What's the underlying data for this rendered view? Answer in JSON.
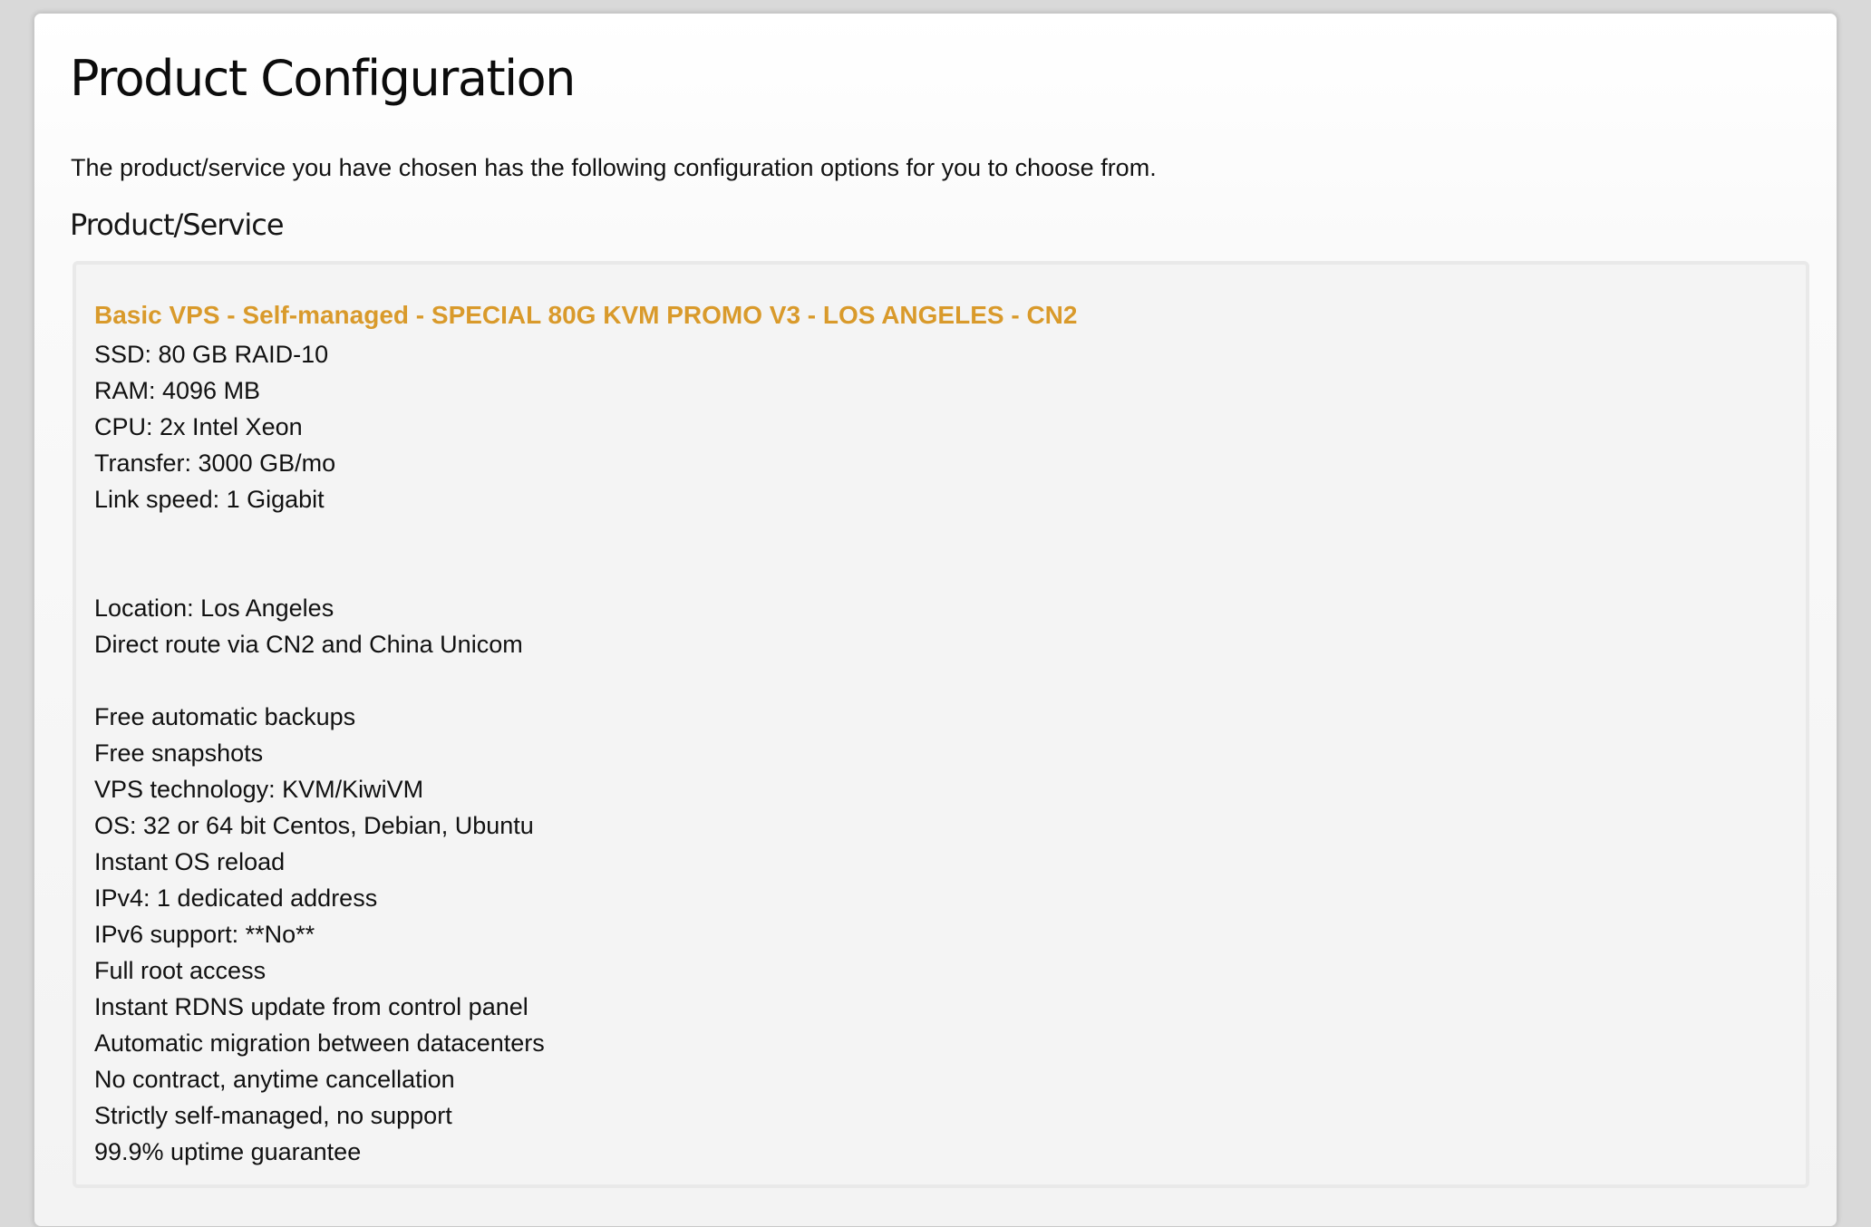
{
  "page": {
    "title": "Product Configuration",
    "intro": "The product/service you have chosen has the following configuration options for you to choose from.",
    "section_heading": "Product/Service"
  },
  "product": {
    "name": "Basic VPS - Self-managed - SPECIAL 80G KVM PROMO V3 - LOS ANGELES - CN2",
    "name_color": "#d99a2b",
    "specs": [
      "SSD: 80 GB RAID-10",
      "RAM: 4096 MB",
      "CPU: 2x Intel Xeon",
      "Transfer: 3000 GB/mo",
      "Link speed: 1 Gigabit",
      "",
      "",
      "Location: Los Angeles",
      "Direct route via CN2 and China Unicom",
      "",
      "Free automatic backups",
      "Free snapshots",
      "VPS technology: KVM/KiwiVM",
      "OS: 32 or 64 bit Centos, Debian, Ubuntu",
      "Instant OS reload",
      "IPv4: 1 dedicated address",
      "IPv6 support: **No**",
      "Full root access",
      "Instant RDNS update from control panel",
      "Automatic migration between datacenters",
      "No contract, anytime cancellation",
      "Strictly self-managed, no support",
      "99.9% uptime guarantee"
    ]
  }
}
